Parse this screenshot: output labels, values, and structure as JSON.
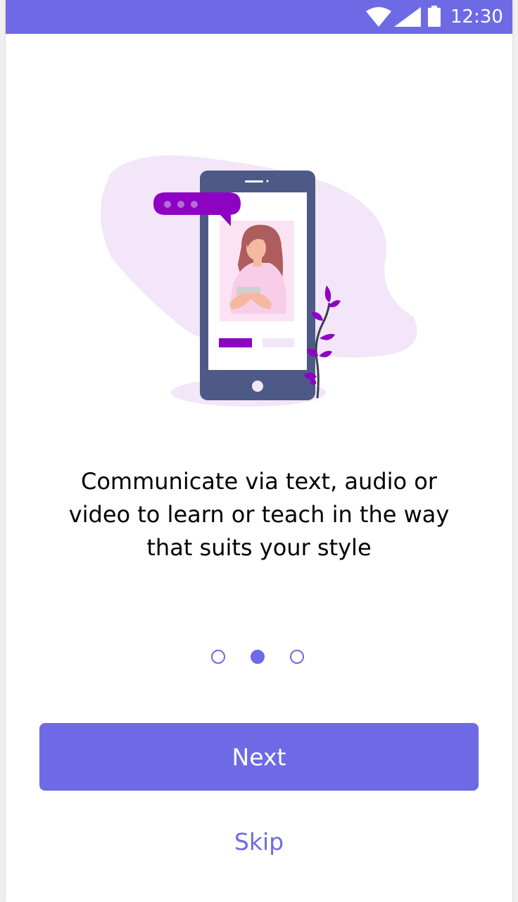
{
  "status_bar": {
    "time": "12:30",
    "icons": [
      "wifi-icon",
      "cellular-signal-icon",
      "battery-icon"
    ],
    "background_color": "#6e6ae6"
  },
  "onboarding": {
    "illustration": "woman-with-phone-illustration",
    "headline": "Communicate via text, audio or video to learn or teach in the way that suits your style",
    "pagination": {
      "total_pages": 3,
      "current_page": 2
    },
    "next_label": "Next",
    "skip_label": "Skip"
  },
  "colors": {
    "accent": "#6e6ae6",
    "illustration_purple": "#8e02c4",
    "blob": "#f3e6f8",
    "phone_body": "#4d5a87"
  }
}
